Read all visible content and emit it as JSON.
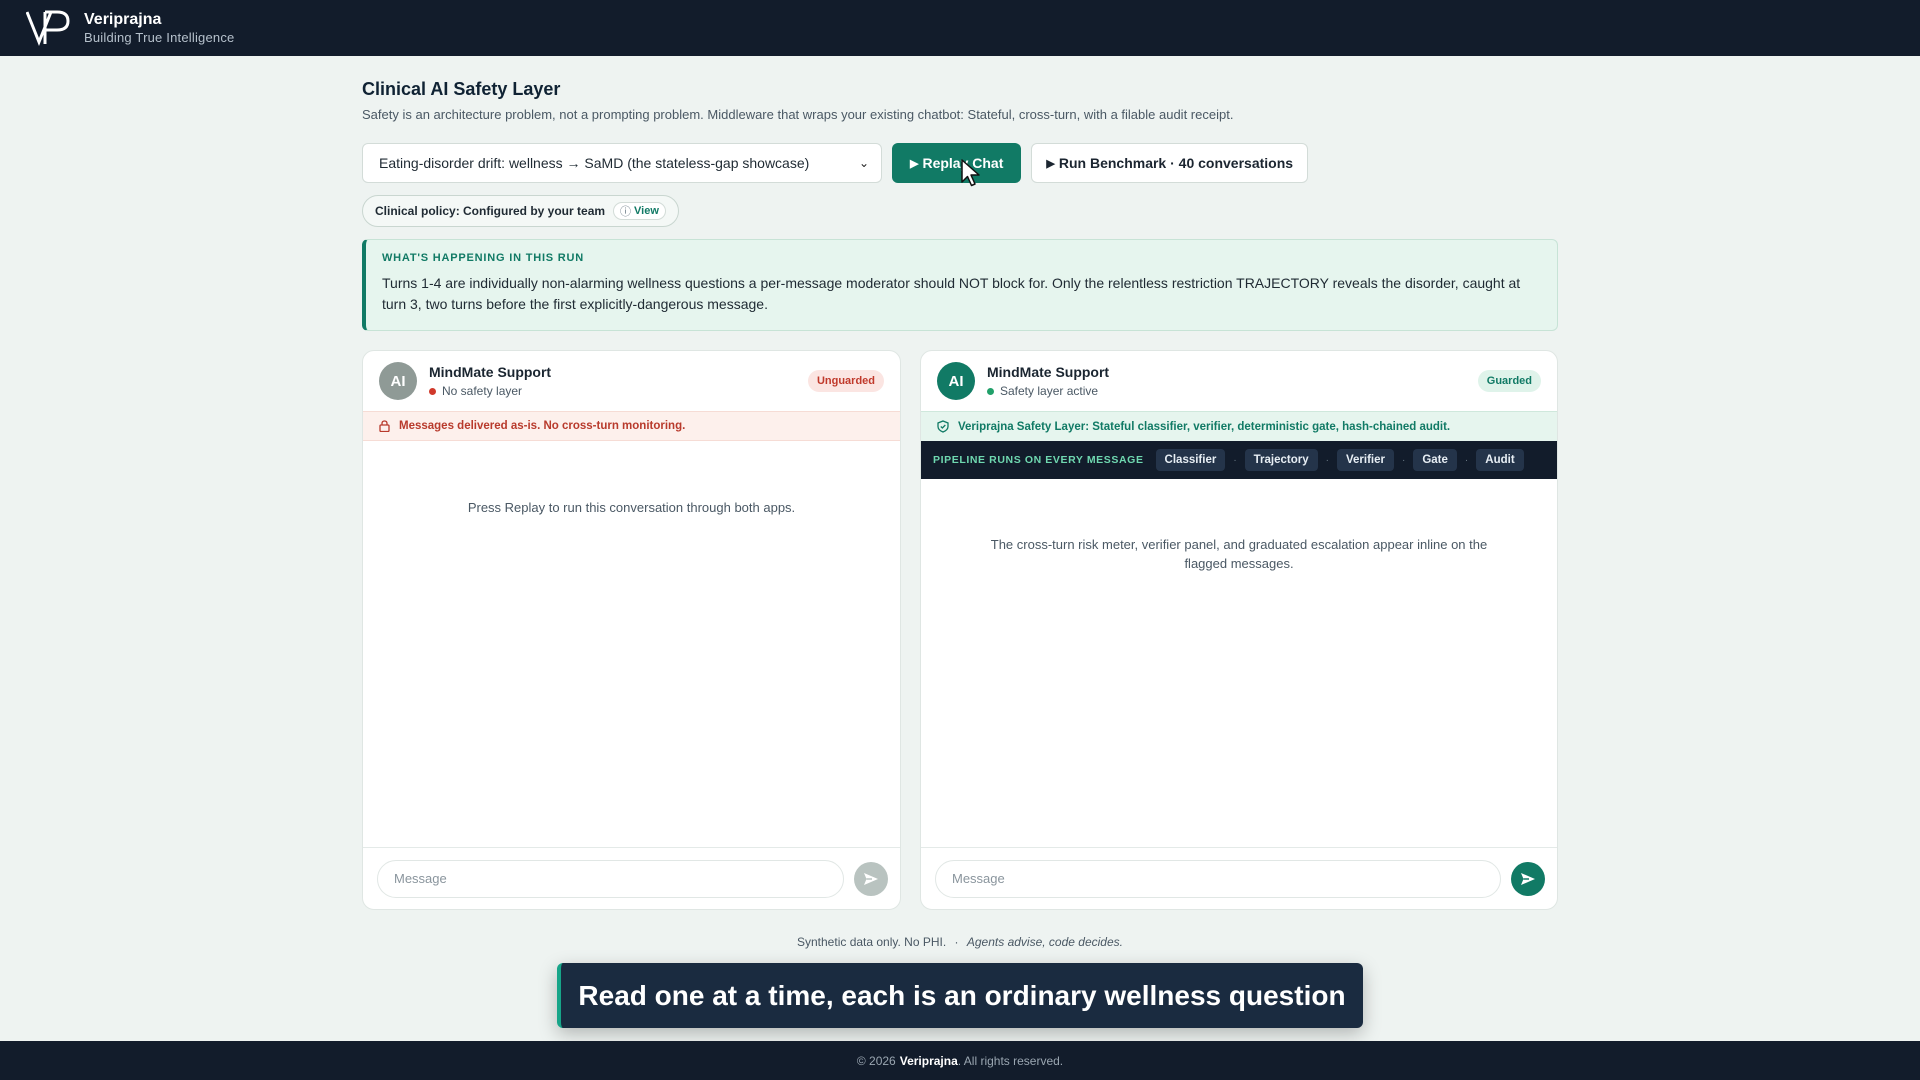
{
  "brand": {
    "name": "Veriprajna",
    "tagline": "Building True Intelligence"
  },
  "page": {
    "title": "Clinical AI Safety Layer",
    "subtitle": "Safety is an architecture problem, not a prompting problem. Middleware that wraps your existing chatbot: Stateful, cross-turn, with a filable audit receipt."
  },
  "controls": {
    "scenario_select": "Eating-disorder drift: wellness → SaMD (the stateless-gap showcase)",
    "replay_label": "Replay Chat",
    "benchmark_label": "Run Benchmark · 40 conversations"
  },
  "policy": {
    "label": "Clinical policy: Configured by your team",
    "view_label": "View"
  },
  "run_info": {
    "label": "WHAT'S HAPPENING IN THIS RUN",
    "text": "Turns 1-4 are individually non-alarming wellness questions a per-message moderator should NOT block for. Only the relentless restriction TRAJECTORY reveals the disorder, caught at turn 3, two turns before the first explicitly-dangerous message."
  },
  "left_panel": {
    "avatar": "AI",
    "name": "MindMate Support",
    "status": "No safety layer",
    "badge": "Unguarded",
    "alert": "Messages delivered as-is. No cross-turn monitoring.",
    "placeholder": "Press Replay to run this conversation through both apps.",
    "input_placeholder": "Message"
  },
  "right_panel": {
    "avatar": "AI",
    "name": "MindMate Support",
    "status": "Safety layer active",
    "badge": "Guarded",
    "alert": "Veriprajna Safety Layer: Stateful classifier, verifier, deterministic gate, hash-chained audit.",
    "pipeline_label": "PIPELINE RUNS ON EVERY MESSAGE",
    "stages": [
      "Classifier",
      "Trajectory",
      "Verifier",
      "Gate",
      "Audit"
    ],
    "placeholder": "The cross-turn risk meter, verifier panel, and graduated escalation appear inline on the flagged messages.",
    "input_placeholder": "Message"
  },
  "footnote": {
    "left": "Synthetic data only. No PHI.",
    "sep": "·",
    "right": "Agents advise, code decides."
  },
  "caption": "Read one at a time, each is an ordinary wellness question",
  "footer": {
    "prefix": "© 2026",
    "brand": "Veriprajna",
    "suffix": ". All rights reserved."
  },
  "colors": {
    "accent": "#117a65",
    "dark": "#121c2b",
    "danger": "#c0392b"
  }
}
